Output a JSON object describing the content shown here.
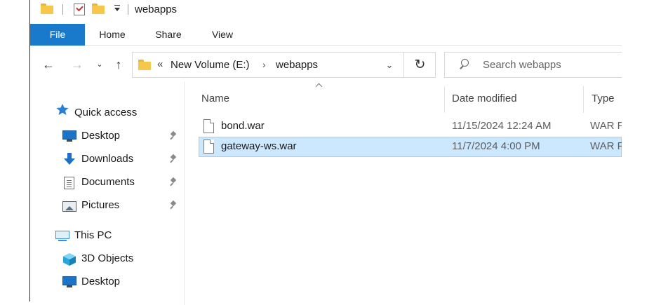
{
  "window": {
    "title": "webapps"
  },
  "ribbon": {
    "tabs": [
      "File",
      "Home",
      "Share",
      "View"
    ]
  },
  "address": {
    "overflow": "«",
    "segments": [
      "New Volume (E:)",
      "webapps"
    ],
    "separator": "›"
  },
  "search": {
    "placeholder": "Search webapps"
  },
  "navpane": {
    "quick_access": "Quick access",
    "pinned": [
      "Desktop",
      "Downloads",
      "Documents",
      "Pictures"
    ],
    "this_pc": "This PC",
    "pc_items": [
      "3D Objects",
      "Desktop"
    ]
  },
  "columns": {
    "name": "Name",
    "date": "Date modified",
    "type": "Type"
  },
  "files": [
    {
      "name": "bond.war",
      "date": "11/15/2024 12:24 AM",
      "type": "WAR F",
      "selected": false
    },
    {
      "name": "gateway-ws.war",
      "date": "11/7/2024 4:00 PM",
      "type": "WAR F",
      "selected": true
    }
  ],
  "colors": {
    "file_tab": "#1979ca",
    "selection": "#cce8ff",
    "folder": "#f5c84b"
  }
}
